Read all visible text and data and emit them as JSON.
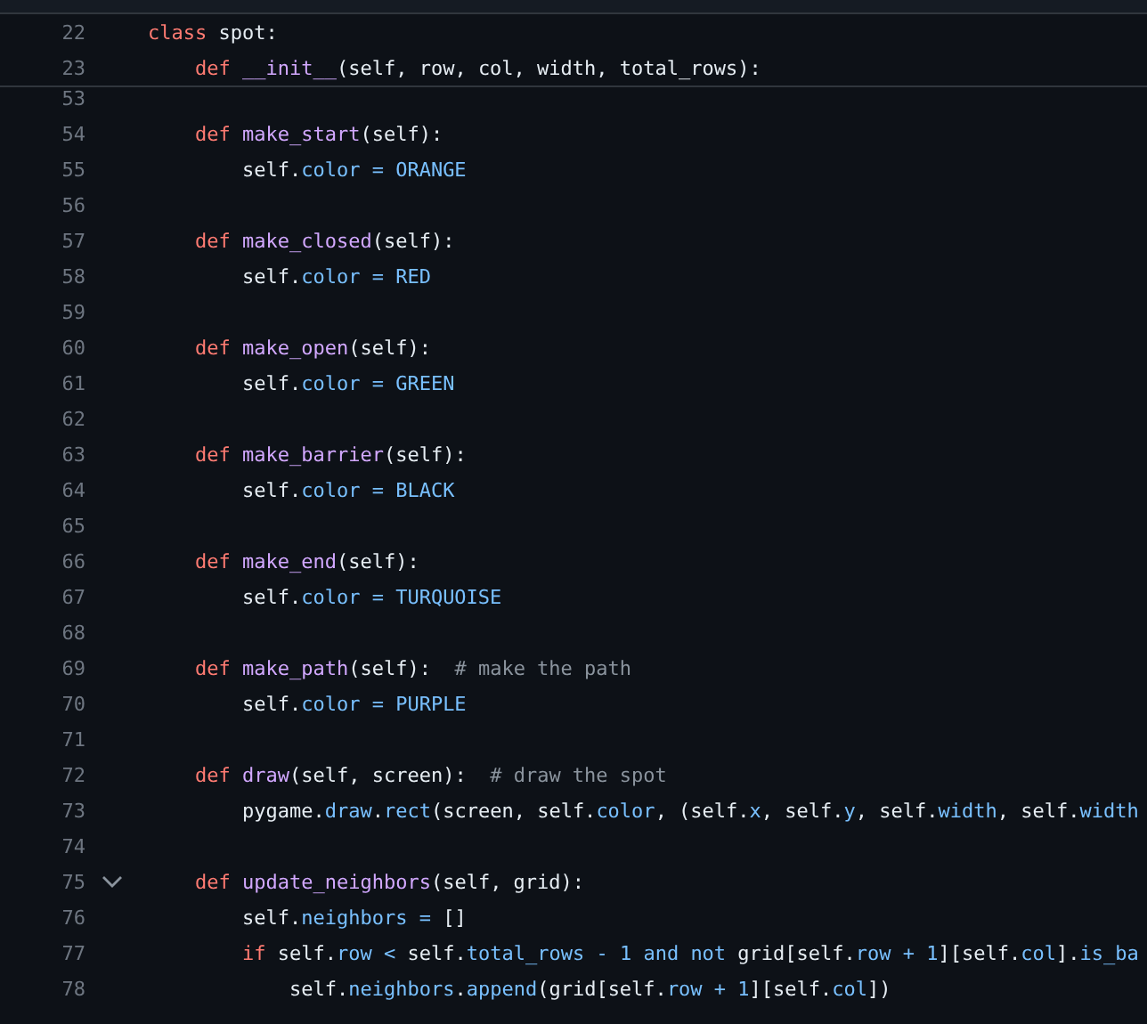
{
  "sticky_lines": [
    {
      "number": "22",
      "expanded_fold": false,
      "tokens": [
        {
          "kind": "keyword",
          "text": "class "
        },
        {
          "kind": "plain",
          "text": "spot:"
        }
      ]
    },
    {
      "number": "23",
      "expanded_fold": false,
      "tokens": [
        {
          "kind": "keyword",
          "text": "    def "
        },
        {
          "kind": "function",
          "text": "__init__"
        },
        {
          "kind": "plain",
          "text": "(self, row, col, width, total_rows):"
        }
      ]
    }
  ],
  "lines": [
    {
      "number": "53",
      "expanded_fold": false
    },
    {
      "number": "54",
      "expanded_fold": false,
      "tokens": [
        {
          "kind": "keyword",
          "text": "    def "
        },
        {
          "kind": "function",
          "text": "make_start"
        },
        {
          "kind": "plain",
          "text": "(self):"
        }
      ]
    },
    {
      "number": "55",
      "expanded_fold": false,
      "tokens": [
        {
          "kind": "plain",
          "text": "        self."
        },
        {
          "kind": "constant",
          "text": "color = ORANGE"
        }
      ]
    },
    {
      "number": "56",
      "expanded_fold": false
    },
    {
      "number": "57",
      "expanded_fold": false,
      "tokens": [
        {
          "kind": "keyword",
          "text": "    def "
        },
        {
          "kind": "function",
          "text": "make_closed"
        },
        {
          "kind": "plain",
          "text": "(self):"
        }
      ]
    },
    {
      "number": "58",
      "expanded_fold": false,
      "tokens": [
        {
          "kind": "plain",
          "text": "        self."
        },
        {
          "kind": "constant",
          "text": "color = RED"
        }
      ]
    },
    {
      "number": "59",
      "expanded_fold": false
    },
    {
      "number": "60",
      "expanded_fold": false,
      "tokens": [
        {
          "kind": "keyword",
          "text": "    def "
        },
        {
          "kind": "function",
          "text": "make_open"
        },
        {
          "kind": "plain",
          "text": "(self):"
        }
      ]
    },
    {
      "number": "61",
      "expanded_fold": false,
      "tokens": [
        {
          "kind": "plain",
          "text": "        self."
        },
        {
          "kind": "constant",
          "text": "color = GREEN"
        }
      ]
    },
    {
      "number": "62",
      "expanded_fold": false
    },
    {
      "number": "63",
      "expanded_fold": false,
      "tokens": [
        {
          "kind": "keyword",
          "text": "    def "
        },
        {
          "kind": "function",
          "text": "make_barrier"
        },
        {
          "kind": "plain",
          "text": "(self):"
        }
      ]
    },
    {
      "number": "64",
      "expanded_fold": false,
      "tokens": [
        {
          "kind": "plain",
          "text": "        self."
        },
        {
          "kind": "constant",
          "text": "color = BLACK"
        }
      ]
    },
    {
      "number": "65",
      "expanded_fold": false
    },
    {
      "number": "66",
      "expanded_fold": false,
      "tokens": [
        {
          "kind": "keyword",
          "text": "    def "
        },
        {
          "kind": "function",
          "text": "make_end"
        },
        {
          "kind": "plain",
          "text": "(self):"
        }
      ]
    },
    {
      "number": "67",
      "expanded_fold": false,
      "tokens": [
        {
          "kind": "plain",
          "text": "        self."
        },
        {
          "kind": "constant",
          "text": "color = TURQUOISE"
        }
      ]
    },
    {
      "number": "68",
      "expanded_fold": false
    },
    {
      "number": "69",
      "expanded_fold": false,
      "tokens": [
        {
          "kind": "keyword",
          "text": "    def "
        },
        {
          "kind": "function",
          "text": "make_path"
        },
        {
          "kind": "plain",
          "text": "(self):  "
        },
        {
          "kind": "comment",
          "text": "# make the path"
        }
      ]
    },
    {
      "number": "70",
      "expanded_fold": false,
      "tokens": [
        {
          "kind": "plain",
          "text": "        self."
        },
        {
          "kind": "constant",
          "text": "color = PURPLE"
        }
      ]
    },
    {
      "number": "71",
      "expanded_fold": false
    },
    {
      "number": "72",
      "expanded_fold": false,
      "tokens": [
        {
          "kind": "keyword",
          "text": "    def "
        },
        {
          "kind": "function",
          "text": "draw"
        },
        {
          "kind": "plain",
          "text": "(self, screen):  "
        },
        {
          "kind": "comment",
          "text": "# draw the spot"
        }
      ]
    },
    {
      "number": "73",
      "expanded_fold": false,
      "tokens": [
        {
          "kind": "plain",
          "text": "        pygame."
        },
        {
          "kind": "constant",
          "text": "draw"
        },
        {
          "kind": "plain",
          "text": "."
        },
        {
          "kind": "constant",
          "text": "rect"
        },
        {
          "kind": "plain",
          "text": "(screen, self."
        },
        {
          "kind": "constant",
          "text": "color"
        },
        {
          "kind": "plain",
          "text": ", (self."
        },
        {
          "kind": "constant",
          "text": "x"
        },
        {
          "kind": "plain",
          "text": ", self."
        },
        {
          "kind": "constant",
          "text": "y"
        },
        {
          "kind": "plain",
          "text": ", self."
        },
        {
          "kind": "constant",
          "text": "width"
        },
        {
          "kind": "plain",
          "text": ", self."
        },
        {
          "kind": "constant",
          "text": "width"
        }
      ]
    },
    {
      "number": "74",
      "expanded_fold": false
    },
    {
      "number": "75",
      "expanded_fold": true,
      "tokens": [
        {
          "kind": "keyword",
          "text": "    def "
        },
        {
          "kind": "function",
          "text": "update_neighbors"
        },
        {
          "kind": "plain",
          "text": "(self, grid):"
        }
      ]
    },
    {
      "number": "76",
      "expanded_fold": false,
      "tokens": [
        {
          "kind": "plain",
          "text": "        self."
        },
        {
          "kind": "constant",
          "text": "neighbors ="
        },
        {
          "kind": "plain",
          "text": " []"
        }
      ]
    },
    {
      "number": "77",
      "expanded_fold": false,
      "tokens": [
        {
          "kind": "keyword",
          "text": "        if "
        },
        {
          "kind": "plain",
          "text": "self."
        },
        {
          "kind": "constant",
          "text": "row <"
        },
        {
          "kind": "plain",
          "text": " self."
        },
        {
          "kind": "constant",
          "text": "total_rows - 1 and not"
        },
        {
          "kind": "plain",
          "text": " grid[self."
        },
        {
          "kind": "constant",
          "text": "row + 1"
        },
        {
          "kind": "plain",
          "text": "][self."
        },
        {
          "kind": "constant",
          "text": "col"
        },
        {
          "kind": "plain",
          "text": "]."
        },
        {
          "kind": "constant",
          "text": "is_ba"
        }
      ]
    },
    {
      "number": "78",
      "expanded_fold": false,
      "tokens": [
        {
          "kind": "plain",
          "text": "            self."
        },
        {
          "kind": "constant",
          "text": "neighbors"
        },
        {
          "kind": "plain",
          "text": "."
        },
        {
          "kind": "constant",
          "text": "append"
        },
        {
          "kind": "plain",
          "text": "(grid[self."
        },
        {
          "kind": "constant",
          "text": "row + 1"
        },
        {
          "kind": "plain",
          "text": "][self."
        },
        {
          "kind": "constant",
          "text": "col"
        },
        {
          "kind": "plain",
          "text": "])"
        }
      ]
    }
  ]
}
